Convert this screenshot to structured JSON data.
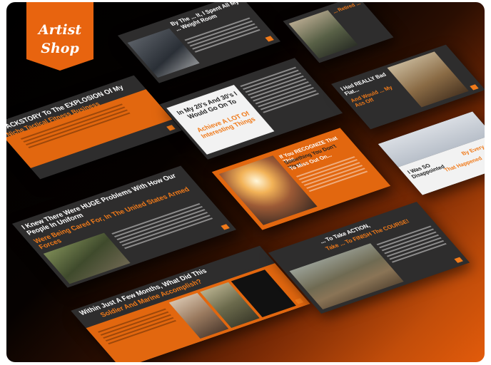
{
  "logo": {
    "line1": "Artist",
    "line2": "Shop"
  },
  "slides": {
    "weight_room": {
      "title": "By The ... It, I Spent All My ... Weight Room"
    },
    "kettlebell": {
      "title": "... Retired ..."
    },
    "backstory": {
      "line1": "BACKSTORY To The EXPLOSION Of My",
      "line2": "Niche Tactical Fitness Business"
    },
    "twenties": {
      "part1": "In My 20's And 30's I Would Go On To",
      "part2": "Achieve A LOT Of Interesting Things"
    },
    "boots": {
      "line1": "I Had REALLY Bad Flat...",
      "line2": "And Would ... My Ass Off"
    },
    "recognize": {
      "line1": "If You RECOGNIZE That This",
      "line2": "Something You Don't Want",
      "line3": "To Miss Out On..."
    },
    "disappointed": {
      "part1": "I Was SO Disappointed",
      "part2": "By Every...",
      "part3": "That Happened"
    },
    "problems": {
      "part1": "I Knew There Were HUGE Problems With How Our People In Uniform",
      "part2": "Were Being Cared For, In The United States Armed Forces"
    },
    "action": {
      "part1": "... To Take ACTION,",
      "part2": "Take ... To FINISH The COURSE!"
    },
    "months": {
      "part1": "Within Just A Few Months, What Did This",
      "part2": "Soldier And Marine Accomplish?"
    }
  },
  "colors": {
    "accent": "#e2670f",
    "dark_slide": "#2e2d2d"
  }
}
